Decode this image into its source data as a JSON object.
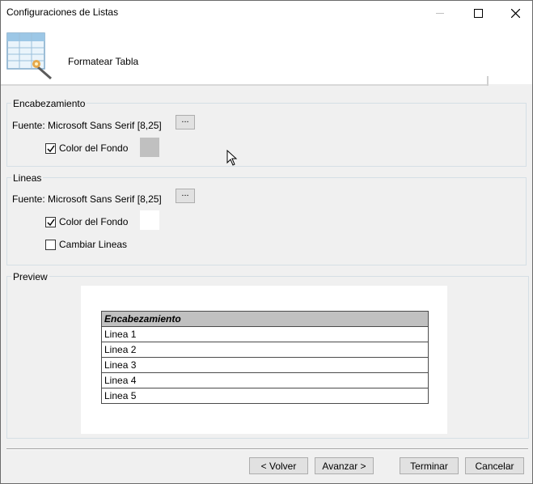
{
  "window": {
    "title": "Configuraciones de Listas"
  },
  "titlebar_buttons": {
    "minimize": "—",
    "maximize": "☐",
    "close": "✕"
  },
  "header": {
    "label": "Formatear Tabla"
  },
  "encabezamiento": {
    "group_title": "Encabezamiento",
    "font_label": "Fuente: Microsoft Sans Serif [8,25]",
    "font_button": "...",
    "bg_color_label": "Color del Fondo",
    "bg_color_checked": true,
    "bg_color": "#c0c0c0"
  },
  "lineas": {
    "group_title": "Lineas",
    "font_label": "Fuente:  Microsoft Sans Serif [8,25]",
    "font_button": "...",
    "bg_color_label": "Color del Fondo",
    "bg_color_checked": true,
    "bg_color": "#ffffff",
    "change_lines_label": "Cambiar Lineas",
    "change_lines_checked": false
  },
  "preview": {
    "group_title": "Preview",
    "header": "Encabezamiento",
    "rows": [
      "Linea 1",
      "Linea 2",
      "Linea 3",
      "Linea 4",
      "Linea 5"
    ]
  },
  "footer": {
    "back": "< Volver",
    "next": "Avanzar >",
    "finish": "Terminar",
    "cancel": "Cancelar"
  }
}
